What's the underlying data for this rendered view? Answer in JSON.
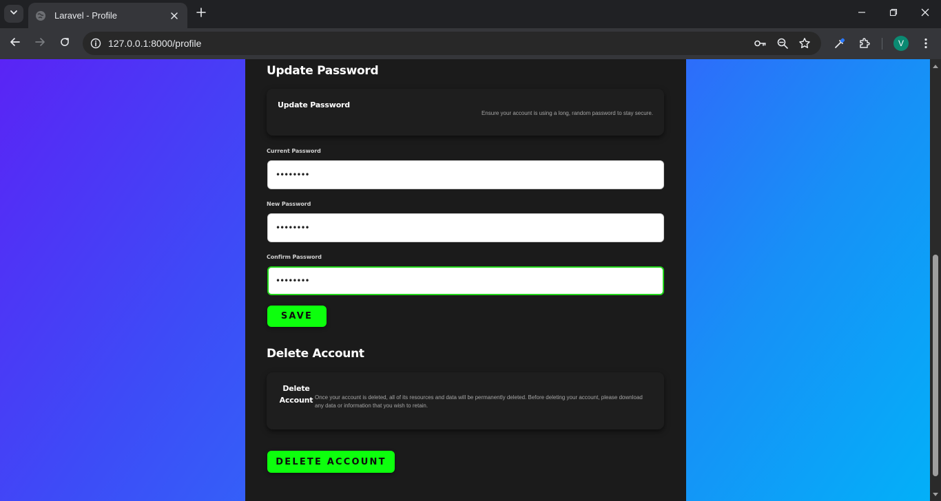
{
  "browser": {
    "tab_title": "Laravel - Profile",
    "url": "127.0.0.1:8000/profile",
    "profile_initial": "V"
  },
  "update_password": {
    "heading": "Update Password",
    "box_title": "Update Password",
    "box_description": "Ensure your account is using a long, random password to stay secure.",
    "current_label": "Current Password",
    "current_value": "••••••••",
    "new_label": "New Password",
    "new_value": "••••••••",
    "confirm_label": "Confirm Password",
    "confirm_value": "••••••••",
    "save_label": "SAVE"
  },
  "delete_account": {
    "heading": "Delete Account",
    "box_title": "Delete Account",
    "box_description": "Once your account is deleted, all of its resources and data will be permanently deleted. Before deleting your account, please download any data or information that you wish to retain.",
    "button_label": "DELETE ACCOUNT"
  },
  "colors": {
    "accent": "#0dff0d",
    "focus_border": "#22d61a",
    "card_bg": "#1b1b1b",
    "gradient_start": "#5a24f5",
    "gradient_end": "#03b0f8"
  },
  "icons": [
    "tab-search-icon",
    "globe-favicon-icon",
    "close-icon",
    "plus-icon",
    "minimize-icon",
    "restore-icon",
    "window-close-icon",
    "back-arrow-icon",
    "forward-arrow-icon",
    "reload-icon",
    "site-info-icon",
    "password-key-icon",
    "zoom-icon",
    "bookmark-star-icon",
    "eyedropper-icon",
    "extensions-icon",
    "kebab-menu-icon",
    "scroll-up-icon",
    "scroll-down-icon"
  ]
}
